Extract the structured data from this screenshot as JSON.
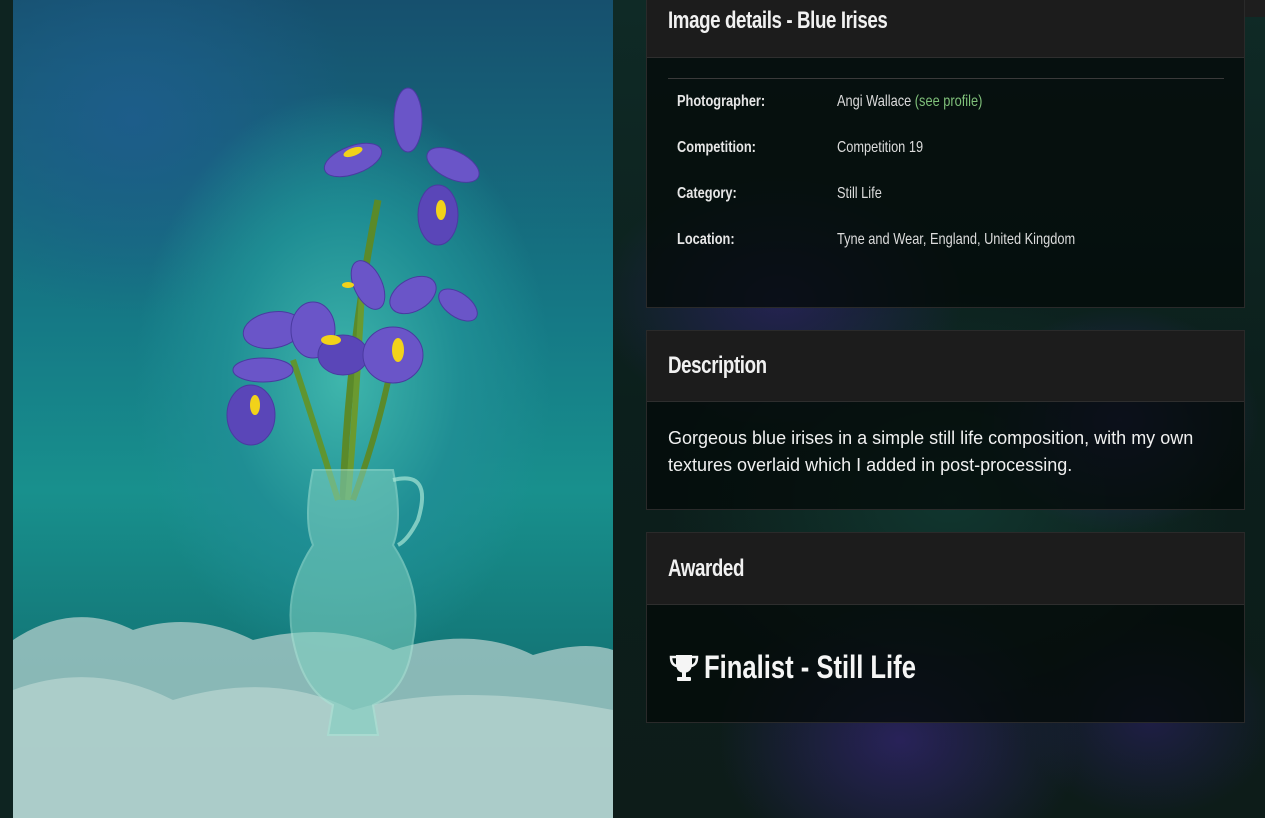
{
  "image_details": {
    "title": "Image details - Blue Irises",
    "rows": [
      {
        "label": "Photographer:",
        "value": "Angi Wallace",
        "link": "(see profile)"
      },
      {
        "label": "Competition:",
        "value": "Competition 19"
      },
      {
        "label": "Category:",
        "value": "Still Life"
      },
      {
        "label": "Location:",
        "value": "Tyne and Wear, England, United Kingdom"
      }
    ]
  },
  "description": {
    "title": "Description",
    "text": "Gorgeous blue irises in a simple still life composition, with my own textures overlaid which I added in post-processing."
  },
  "awarded": {
    "title": "Awarded",
    "icon": "trophy-icon",
    "text": "Finalist - Still Life"
  },
  "colors": {
    "link": "#7fc07a",
    "panel_header": "#1c1c1c",
    "accent": "#2fd05a"
  }
}
